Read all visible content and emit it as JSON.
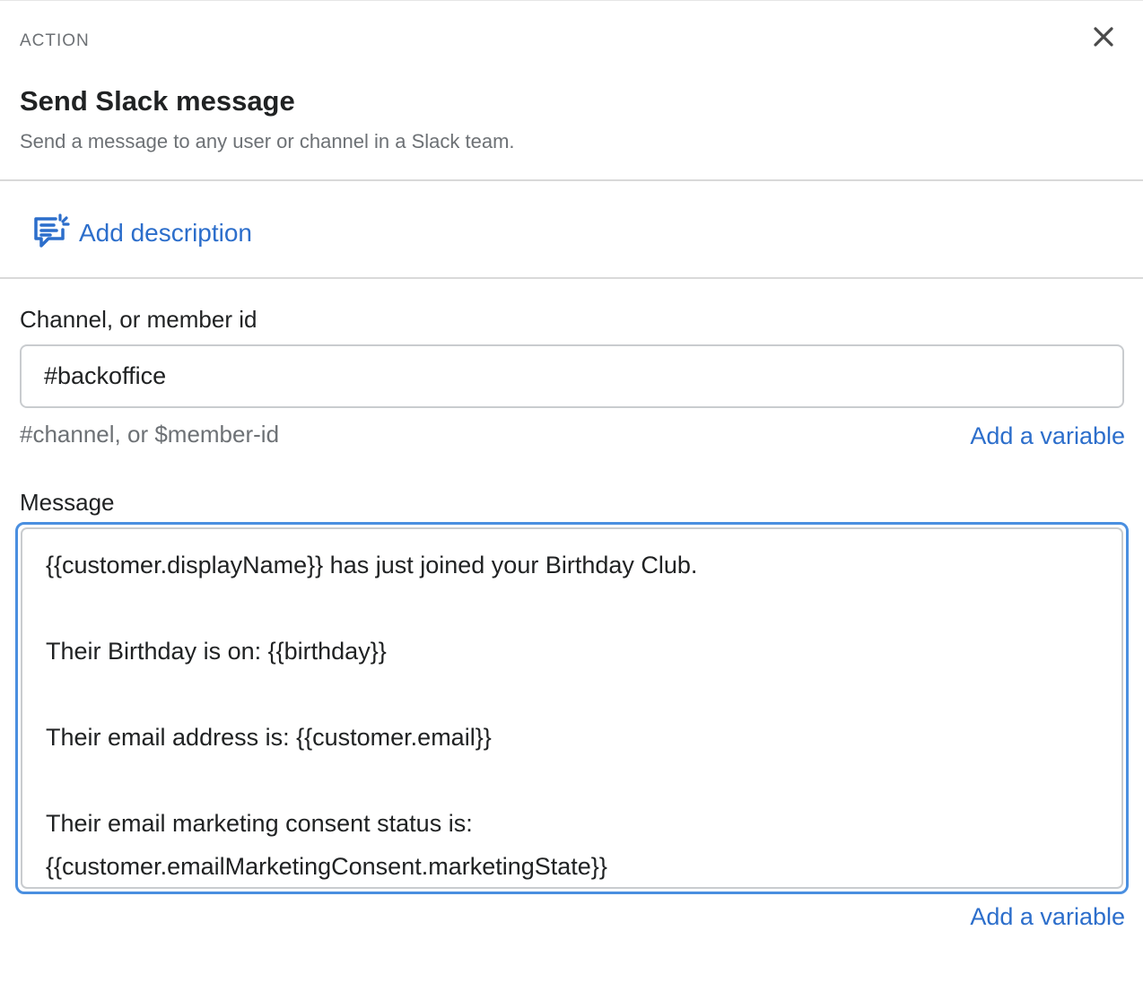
{
  "header": {
    "eyebrow": "ACTION",
    "title": "Send Slack message",
    "subtitle": "Send a message to any user or channel in a Slack team.",
    "close_icon": "close-icon"
  },
  "description": {
    "label": "Add description",
    "icon": "comment-edit-icon"
  },
  "channel_field": {
    "label": "Channel, or member id",
    "value": "#backoffice",
    "help_text": "#channel, or $member-id",
    "add_variable": "Add a variable"
  },
  "message_field": {
    "label": "Message",
    "lines": [
      "{{customer.displayName}} has just joined your Birthday Club.",
      "",
      "Their Birthday is on: {{birthday}}",
      "",
      "Their email address is: {{customer.email}}",
      "",
      "Their email marketing consent status is:",
      "{{customer.emailMarketingConsent.marketingState}}"
    ],
    "add_variable": "Add a variable"
  },
  "colors": {
    "link": "#2c6ecb",
    "focus": "#4a8fe0",
    "text": "#202223",
    "muted": "#6d7175"
  }
}
